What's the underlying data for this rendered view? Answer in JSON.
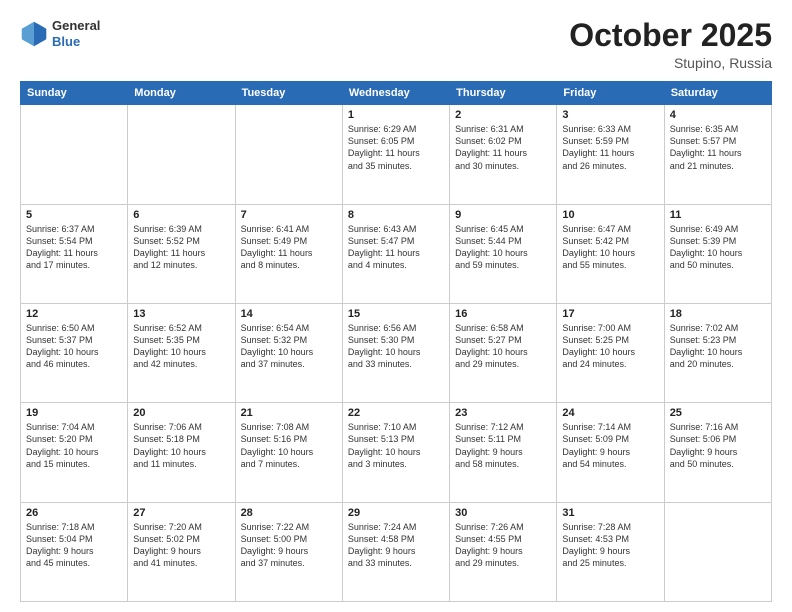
{
  "header": {
    "logo_line1": "General",
    "logo_line2": "Blue",
    "title": "October 2025",
    "location": "Stupino, Russia"
  },
  "days_of_week": [
    "Sunday",
    "Monday",
    "Tuesday",
    "Wednesday",
    "Thursday",
    "Friday",
    "Saturday"
  ],
  "weeks": [
    [
      {
        "day": "",
        "content": ""
      },
      {
        "day": "",
        "content": ""
      },
      {
        "day": "",
        "content": ""
      },
      {
        "day": "1",
        "content": "Sunrise: 6:29 AM\nSunset: 6:05 PM\nDaylight: 11 hours\nand 35 minutes."
      },
      {
        "day": "2",
        "content": "Sunrise: 6:31 AM\nSunset: 6:02 PM\nDaylight: 11 hours\nand 30 minutes."
      },
      {
        "day": "3",
        "content": "Sunrise: 6:33 AM\nSunset: 5:59 PM\nDaylight: 11 hours\nand 26 minutes."
      },
      {
        "day": "4",
        "content": "Sunrise: 6:35 AM\nSunset: 5:57 PM\nDaylight: 11 hours\nand 21 minutes."
      }
    ],
    [
      {
        "day": "5",
        "content": "Sunrise: 6:37 AM\nSunset: 5:54 PM\nDaylight: 11 hours\nand 17 minutes."
      },
      {
        "day": "6",
        "content": "Sunrise: 6:39 AM\nSunset: 5:52 PM\nDaylight: 11 hours\nand 12 minutes."
      },
      {
        "day": "7",
        "content": "Sunrise: 6:41 AM\nSunset: 5:49 PM\nDaylight: 11 hours\nand 8 minutes."
      },
      {
        "day": "8",
        "content": "Sunrise: 6:43 AM\nSunset: 5:47 PM\nDaylight: 11 hours\nand 4 minutes."
      },
      {
        "day": "9",
        "content": "Sunrise: 6:45 AM\nSunset: 5:44 PM\nDaylight: 10 hours\nand 59 minutes."
      },
      {
        "day": "10",
        "content": "Sunrise: 6:47 AM\nSunset: 5:42 PM\nDaylight: 10 hours\nand 55 minutes."
      },
      {
        "day": "11",
        "content": "Sunrise: 6:49 AM\nSunset: 5:39 PM\nDaylight: 10 hours\nand 50 minutes."
      }
    ],
    [
      {
        "day": "12",
        "content": "Sunrise: 6:50 AM\nSunset: 5:37 PM\nDaylight: 10 hours\nand 46 minutes."
      },
      {
        "day": "13",
        "content": "Sunrise: 6:52 AM\nSunset: 5:35 PM\nDaylight: 10 hours\nand 42 minutes."
      },
      {
        "day": "14",
        "content": "Sunrise: 6:54 AM\nSunset: 5:32 PM\nDaylight: 10 hours\nand 37 minutes."
      },
      {
        "day": "15",
        "content": "Sunrise: 6:56 AM\nSunset: 5:30 PM\nDaylight: 10 hours\nand 33 minutes."
      },
      {
        "day": "16",
        "content": "Sunrise: 6:58 AM\nSunset: 5:27 PM\nDaylight: 10 hours\nand 29 minutes."
      },
      {
        "day": "17",
        "content": "Sunrise: 7:00 AM\nSunset: 5:25 PM\nDaylight: 10 hours\nand 24 minutes."
      },
      {
        "day": "18",
        "content": "Sunrise: 7:02 AM\nSunset: 5:23 PM\nDaylight: 10 hours\nand 20 minutes."
      }
    ],
    [
      {
        "day": "19",
        "content": "Sunrise: 7:04 AM\nSunset: 5:20 PM\nDaylight: 10 hours\nand 15 minutes."
      },
      {
        "day": "20",
        "content": "Sunrise: 7:06 AM\nSunset: 5:18 PM\nDaylight: 10 hours\nand 11 minutes."
      },
      {
        "day": "21",
        "content": "Sunrise: 7:08 AM\nSunset: 5:16 PM\nDaylight: 10 hours\nand 7 minutes."
      },
      {
        "day": "22",
        "content": "Sunrise: 7:10 AM\nSunset: 5:13 PM\nDaylight: 10 hours\nand 3 minutes."
      },
      {
        "day": "23",
        "content": "Sunrise: 7:12 AM\nSunset: 5:11 PM\nDaylight: 9 hours\nand 58 minutes."
      },
      {
        "day": "24",
        "content": "Sunrise: 7:14 AM\nSunset: 5:09 PM\nDaylight: 9 hours\nand 54 minutes."
      },
      {
        "day": "25",
        "content": "Sunrise: 7:16 AM\nSunset: 5:06 PM\nDaylight: 9 hours\nand 50 minutes."
      }
    ],
    [
      {
        "day": "26",
        "content": "Sunrise: 7:18 AM\nSunset: 5:04 PM\nDaylight: 9 hours\nand 45 minutes."
      },
      {
        "day": "27",
        "content": "Sunrise: 7:20 AM\nSunset: 5:02 PM\nDaylight: 9 hours\nand 41 minutes."
      },
      {
        "day": "28",
        "content": "Sunrise: 7:22 AM\nSunset: 5:00 PM\nDaylight: 9 hours\nand 37 minutes."
      },
      {
        "day": "29",
        "content": "Sunrise: 7:24 AM\nSunset: 4:58 PM\nDaylight: 9 hours\nand 33 minutes."
      },
      {
        "day": "30",
        "content": "Sunrise: 7:26 AM\nSunset: 4:55 PM\nDaylight: 9 hours\nand 29 minutes."
      },
      {
        "day": "31",
        "content": "Sunrise: 7:28 AM\nSunset: 4:53 PM\nDaylight: 9 hours\nand 25 minutes."
      },
      {
        "day": "",
        "content": ""
      }
    ]
  ]
}
